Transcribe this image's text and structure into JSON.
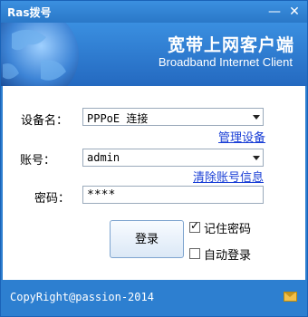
{
  "window": {
    "title": "Ras拨号",
    "minimize_glyph": "—",
    "close_glyph": "✕"
  },
  "banner": {
    "title_cn": "宽带上网客户端",
    "title_en": "Broadband Internet Client"
  },
  "form": {
    "device_label": "设备名：",
    "device_value": "PPPoE 连接",
    "manage_device_link": "管理设备",
    "account_label": "账号：",
    "account_value": "admin",
    "clear_account_link": "清除账号信息",
    "password_label": "密码：",
    "password_value": "****",
    "login_button": "登录",
    "remember_password_label": "记住密码",
    "remember_password_checked": true,
    "auto_login_label": "自动登录",
    "auto_login_checked": false
  },
  "footer": {
    "copyright": "CopyRight@passion-2014",
    "mail_icon": "mail-icon"
  },
  "colors": {
    "frame": "#2d7fd0",
    "link": "#1a3fd6"
  }
}
